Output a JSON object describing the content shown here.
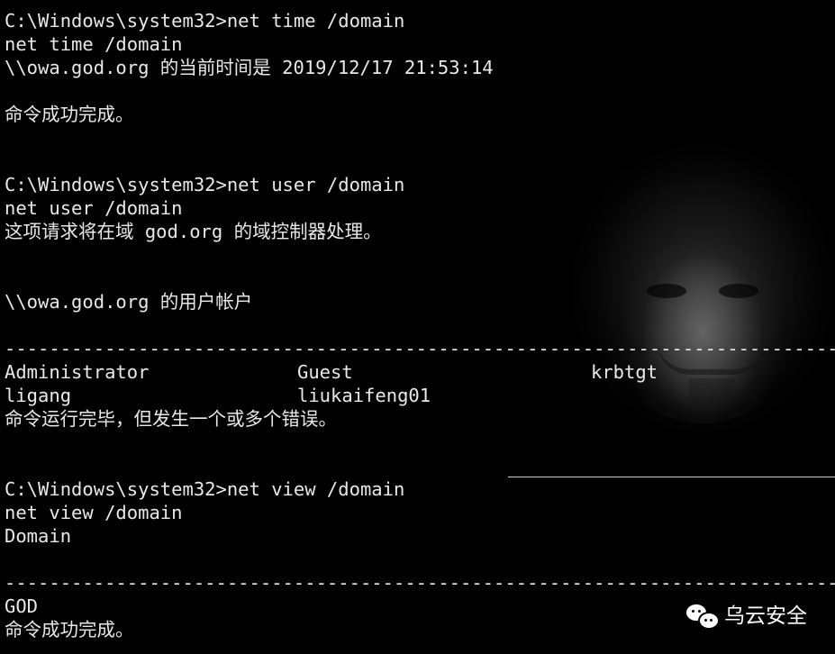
{
  "console": {
    "block1": {
      "prompt": "C:\\Windows\\system32>net time /domain",
      "echo": "net time /domain",
      "result": "\\\\owa.god.org 的当前时间是 2019/12/17 21:53:14",
      "status": "命令成功完成。"
    },
    "block2": {
      "prompt": "C:\\Windows\\system32>net user /domain",
      "echo": "net user /domain",
      "info": "这项请求将在域 god.org 的域控制器处理。",
      "accounts_header": "\\\\owa.god.org 的用户帐户",
      "separator": "-------------------------------------------------------------------------------",
      "accounts": [
        [
          "Administrator",
          "Guest",
          "krbtgt"
        ],
        [
          "ligang",
          "liukaifeng01",
          ""
        ]
      ],
      "status": "命令运行完毕，但发生一个或多个错误。"
    },
    "block3": {
      "prompt": "C:\\Windows\\system32>net view /domain",
      "echo": "net view /domain",
      "header": "Domain",
      "separator": "-------------------------------------------------------------------------------",
      "domain": "GOD",
      "status": "命令成功完成。"
    }
  },
  "watermark": {
    "icon": "wechat-icon",
    "text": "乌云安全"
  }
}
